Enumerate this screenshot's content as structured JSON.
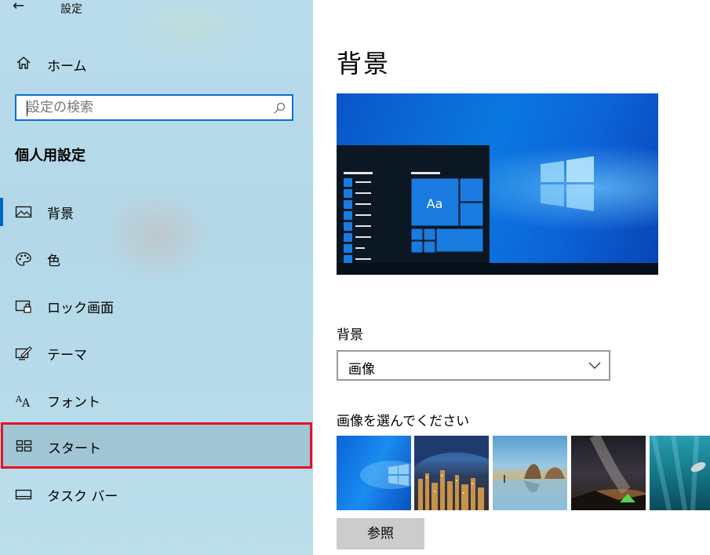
{
  "window": {
    "title": "設定"
  },
  "sidebar": {
    "home_label": "ホーム",
    "search": {
      "placeholder": "設定の検索",
      "value": ""
    },
    "section_title": "個人用設定",
    "items": [
      {
        "label": "背景",
        "icon": "picture-icon",
        "active": true
      },
      {
        "label": "色",
        "icon": "palette-icon"
      },
      {
        "label": "ロック画面",
        "icon": "lock-screen-icon"
      },
      {
        "label": "テーマ",
        "icon": "theme-icon"
      },
      {
        "label": "フォント",
        "icon": "font-icon"
      },
      {
        "label": "スタート",
        "icon": "start-tiles-icon",
        "highlighted": true
      },
      {
        "label": "タスク バー",
        "icon": "taskbar-icon"
      }
    ]
  },
  "main": {
    "title": "背景",
    "preview": {
      "tile_text": "Aa"
    },
    "background_label": "背景",
    "background_value": "画像",
    "choose_label": "画像を選んでください",
    "thumbnails": [
      "windows-blue",
      "city-night",
      "beach-rocks",
      "milky-way-tent",
      "underwater-swimmer"
    ],
    "browse_label": "参照"
  },
  "colors": {
    "accent": "#0067c0",
    "highlight_border": "#e81123",
    "search_border": "#0a6fd1"
  }
}
